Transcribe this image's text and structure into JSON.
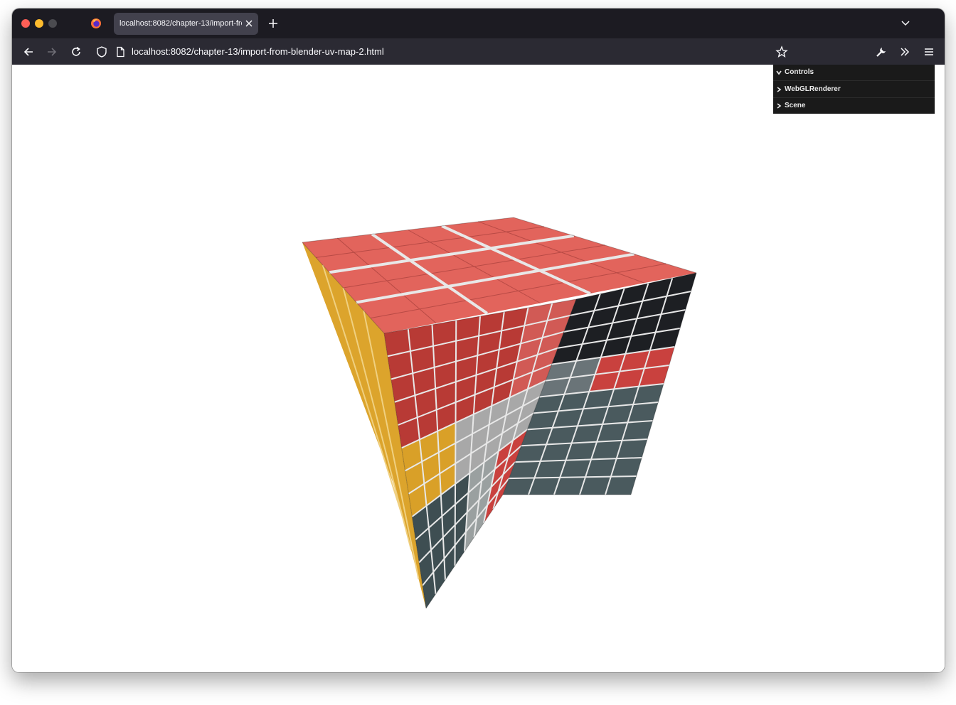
{
  "browser": {
    "tab_title": "localhost:8082/chapter-13/import-from-blender-uv-map-2.html",
    "url": "localhost:8082/chapter-13/import-from-blender-uv-map-2.html"
  },
  "gui": {
    "items": [
      {
        "label": "Controls",
        "expanded": true
      },
      {
        "label": "WebGLRenderer",
        "expanded": false
      },
      {
        "label": "Scene",
        "expanded": false
      }
    ]
  },
  "scene": {
    "colors": {
      "top": "#e2645c",
      "front_red": "#b83a35",
      "front_yellow": "#d9a028",
      "front_slate": "#3e4e52",
      "right_dark": "#1d1f23",
      "right_red": "#c9413e",
      "right_slate": "#4a5a5e",
      "left": "#dca42c",
      "grid": "#e8e8e8"
    }
  }
}
